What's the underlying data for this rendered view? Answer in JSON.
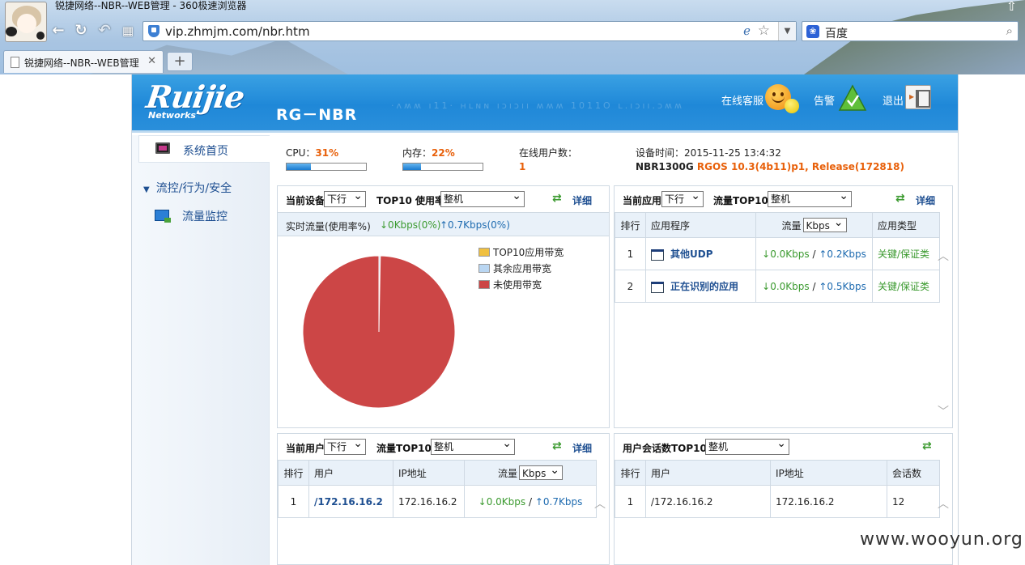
{
  "browser": {
    "window_title": "锐捷网络--NBR--WEB管理 - 360极速浏览器",
    "url": "vip.zhmjm.com/nbr.htm",
    "search_engine": "百度",
    "tab_title": "锐捷网络--NBR--WEB管理",
    "tab_close": "✕",
    "new_tab": "+",
    "back": "←",
    "refresh": "↻",
    "undo": "↶",
    "apps": "▦",
    "pin": "⇧"
  },
  "header": {
    "logo": "Ruijie",
    "logo_sub": "Networks",
    "product": "RG－NBR",
    "decor_text": "·ʌʍʍ ı11· ʜʟɴɴ ıɔıɔıı ʍʍʍ 1011O ʟ.ıɔıı.ɔʍʍ",
    "online_service": "在线客服",
    "alarm": "告警",
    "logout": "退出"
  },
  "sidebar": {
    "home": "系统首页",
    "group": "流控/行为/安全",
    "flow_monitor": "流量监控"
  },
  "status": {
    "cpu_label": "CPU：",
    "cpu_value": "31%",
    "cpu_fraction": 0.31,
    "mem_label": "内存：",
    "mem_value": "22%",
    "mem_fraction": 0.22,
    "online_label": "在线用户数：",
    "online_value": "1",
    "time_label": "设备时间：",
    "time_value": "2015-11-25 13:4:32",
    "model": "NBR1300G",
    "version": "RGOS 10.3(4b11)p1, Release(172818)"
  },
  "device_panel": {
    "title": "当前设备",
    "direction": "下行",
    "top_label": "TOP10 使用率",
    "scope": "整机",
    "detail": "详细",
    "realtime_label": "实时流量(使用率%)",
    "down": "↓0Kbps(0%)",
    "up": "↑0.7Kbps(0%)",
    "legend": [
      {
        "label": "TOP10应用带宽",
        "color": "#f0c040"
      },
      {
        "label": "其余应用带宽",
        "color": "#b9d6f2"
      },
      {
        "label": "未使用带宽",
        "color": "#cc4646"
      }
    ]
  },
  "chart_data": {
    "type": "pie",
    "categories": [
      "TOP10应用带宽",
      "其余应用带宽",
      "未使用带宽"
    ],
    "values": [
      0,
      0.3,
      99.7
    ],
    "colors": [
      "#f0c040",
      "#b9d6f2",
      "#cc4646"
    ],
    "legend": "right"
  },
  "app_panel": {
    "title": "当前应用",
    "direction": "下行",
    "top_label": "流量TOP10",
    "scope": "整机",
    "detail": "详细",
    "columns": {
      "rank": "排行",
      "app": "应用程序",
      "flow": "流量",
      "unit": "Kbps",
      "type": "应用类型"
    },
    "rows": [
      {
        "rank": "1",
        "app": "其他UDP",
        "down": "↓0.0Kbps",
        "sep": "/",
        "up": "↑0.2Kbps",
        "type": "关键/保证类"
      },
      {
        "rank": "2",
        "app": "正在识别的应用",
        "down": "↓0.0Kbps",
        "sep": "/",
        "up": "↑0.5Kbps",
        "type": "关键/保证类"
      }
    ]
  },
  "user_panel": {
    "title": "当前用户",
    "direction": "下行",
    "top_label": "流量TOP10",
    "scope": "整机",
    "detail": "详细",
    "columns": {
      "rank": "排行",
      "user": "用户",
      "ip": "IP地址",
      "flow": "流量",
      "unit": "Kbps"
    },
    "rows": [
      {
        "rank": "1",
        "user": "/172.16.16.2",
        "ip": "172.16.16.2",
        "down": "↓0.0Kbps",
        "sep": "/",
        "up": "↑0.7Kbps"
      }
    ]
  },
  "session_panel": {
    "title": "用户会话数TOP10",
    "scope": "整机",
    "columns": {
      "rank": "排行",
      "user": "用户",
      "ip": "IP地址",
      "sessions": "会话数"
    },
    "rows": [
      {
        "rank": "1",
        "user": "/172.16.16.2",
        "ip": "172.16.16.2",
        "sessions": "12"
      }
    ]
  },
  "watermark": "www.wooyun.org"
}
